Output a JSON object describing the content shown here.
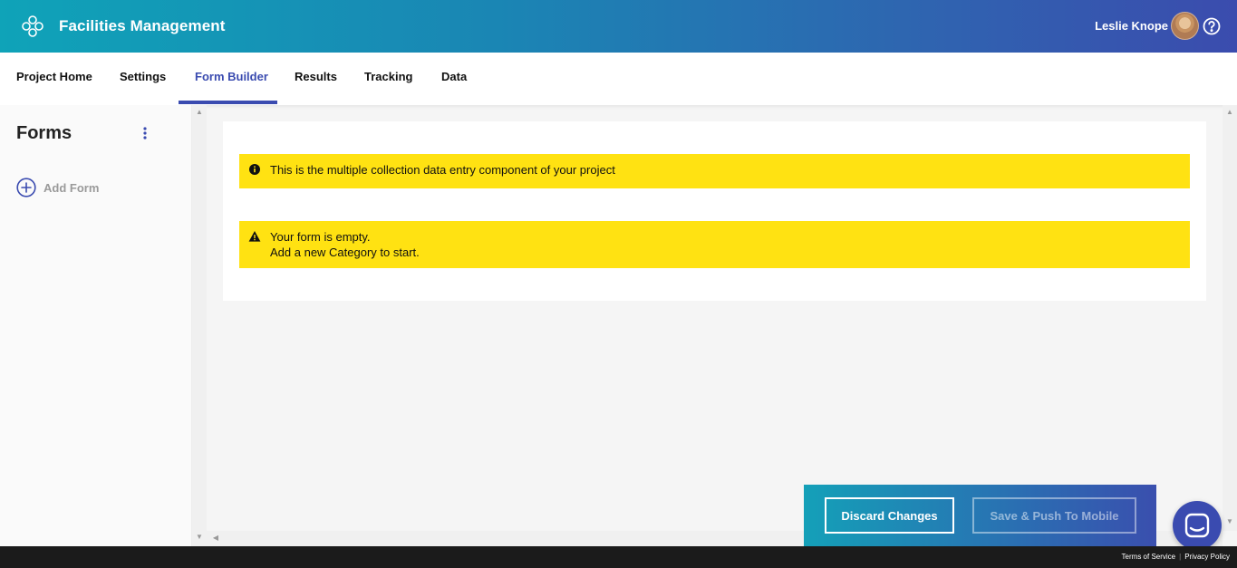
{
  "header": {
    "app_title": "Facilities Management",
    "user_name": "Leslie Knope"
  },
  "tabs": [
    {
      "label": "Project Home"
    },
    {
      "label": "Settings"
    },
    {
      "label": "Form Builder",
      "active": true
    },
    {
      "label": "Results"
    },
    {
      "label": "Tracking"
    },
    {
      "label": "Data"
    }
  ],
  "sidebar": {
    "title": "Forms",
    "add_form_label": "Add Form"
  },
  "banners": {
    "info_text": "This is the multiple collection data entry component of your project",
    "warning_line1": "Your form is empty.",
    "warning_line2": "Add a new Category to start."
  },
  "actions": {
    "discard_label": "Discard Changes",
    "save_label": "Save & Push To Mobile"
  },
  "footer": {
    "terms": "Terms of Service",
    "separator": "|",
    "privacy": "Privacy Policy"
  },
  "colors": {
    "accent": "#3a4bb0",
    "banner": "#ffe212",
    "header_start": "#0fa3b8",
    "header_end": "#3b4cae"
  }
}
